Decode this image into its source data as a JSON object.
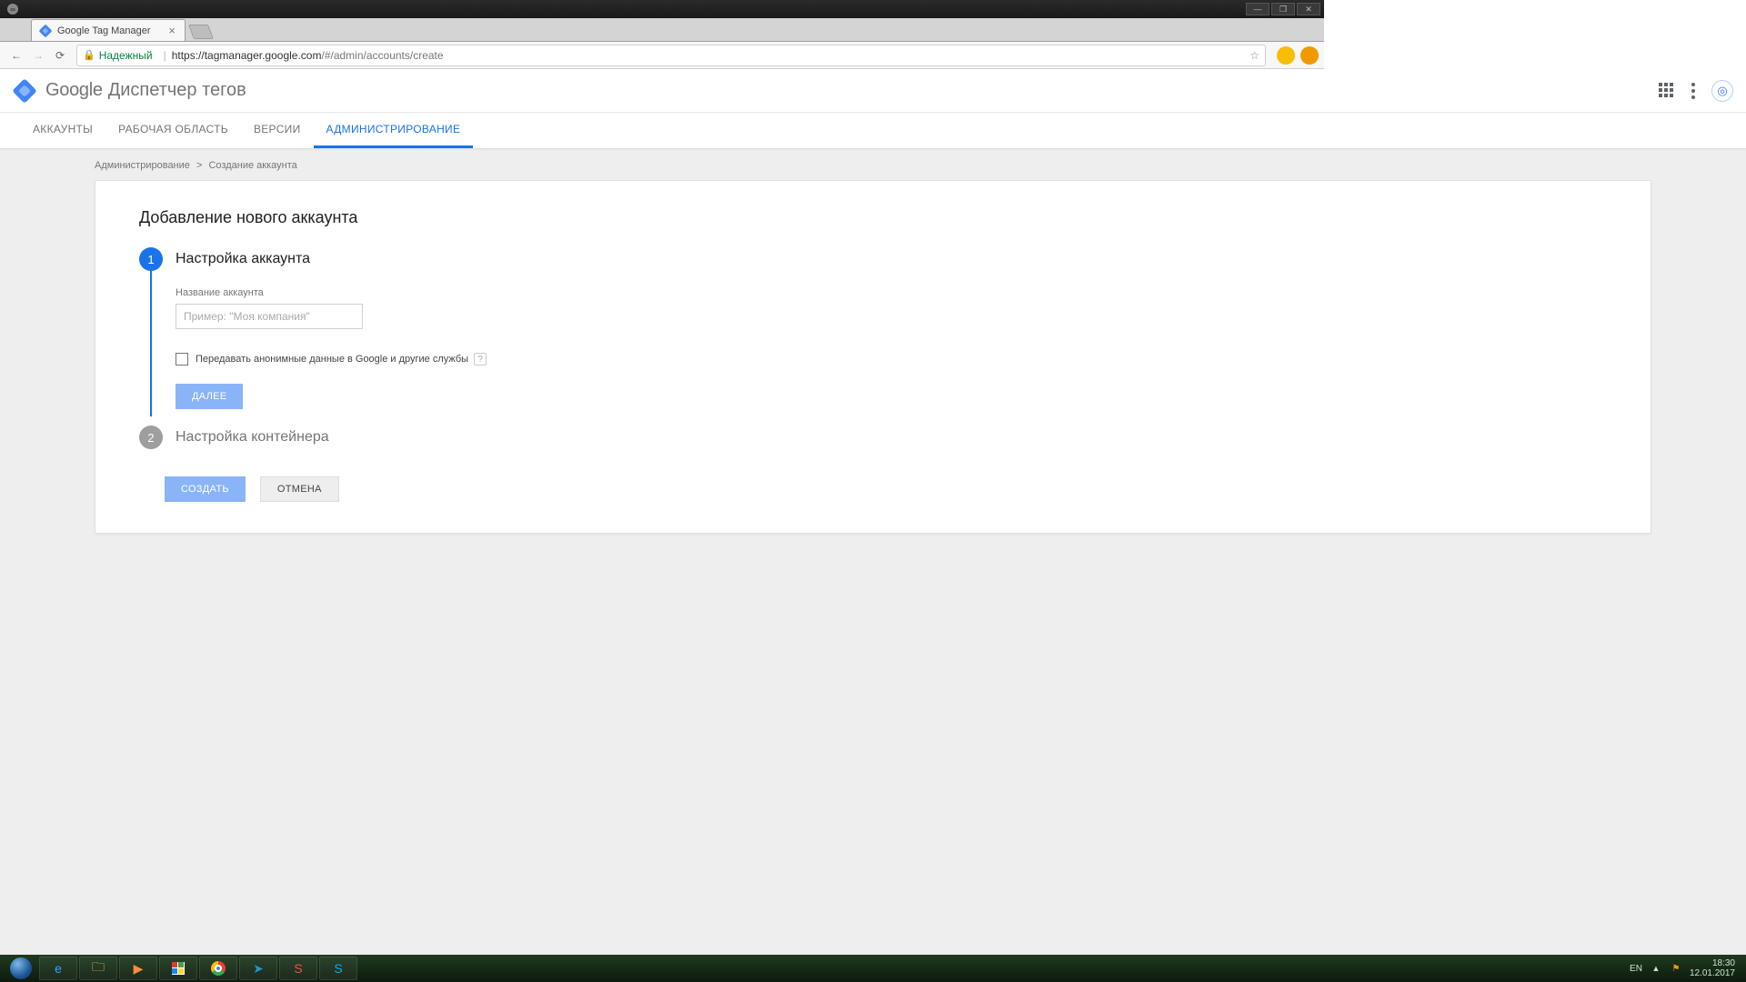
{
  "window": {
    "tab_title": "Google Tag Manager"
  },
  "browser": {
    "secure_label": "Надежный",
    "url_host": "https://tagmanager.google.com",
    "url_path": "/#/admin/accounts/create"
  },
  "header": {
    "brand_google": "Google",
    "brand_product": "Диспетчер тегов"
  },
  "nav": {
    "accounts": "АККАУНТЫ",
    "workspace": "РАБОЧАЯ ОБЛАСТЬ",
    "versions": "ВЕРСИИ",
    "admin": "АДМИНИСТРИРОВАНИЕ"
  },
  "crumbs": {
    "admin": "Администрирование",
    "create": "Создание аккаунта"
  },
  "card": {
    "title": "Добавление нового аккаунта",
    "step1": {
      "num": "1",
      "title": "Настройка аккаунта",
      "account_name_label": "Название аккаунта",
      "account_name_placeholder": "Пример: \"Моя компания\"",
      "share_anon_label": "Передавать анонимные данные в Google и другие службы",
      "next_btn": "ДАЛЕЕ"
    },
    "step2": {
      "num": "2",
      "title": "Настройка контейнера"
    },
    "create_btn": "СОЗДАТЬ",
    "cancel_btn": "ОТМЕНА"
  },
  "taskbar": {
    "lang": "EN",
    "time": "18:30",
    "date": "12.01.2017"
  }
}
